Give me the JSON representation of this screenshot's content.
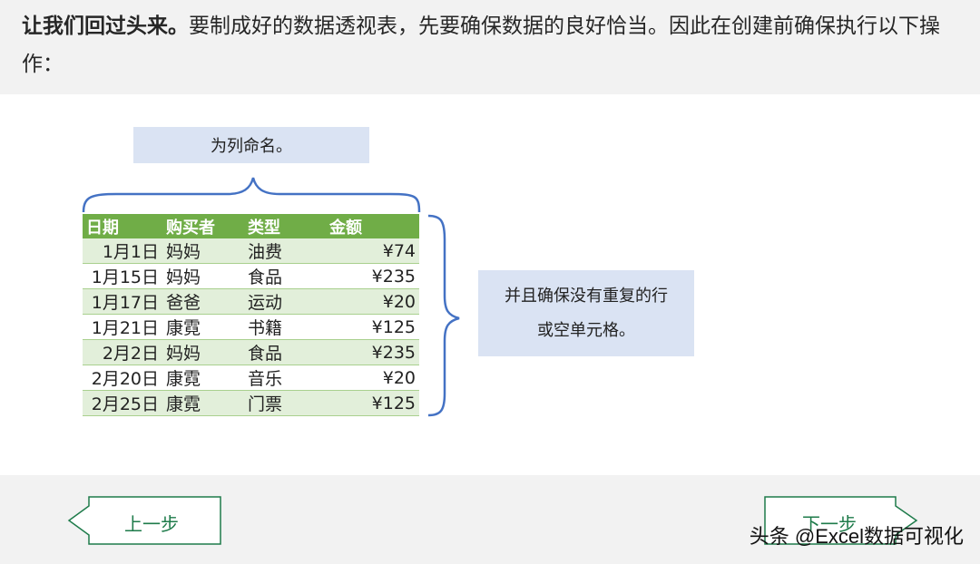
{
  "header": {
    "bold_text": "让我们回过头来。",
    "rest_text": "要制成好的数据透视表，先要确保数据的良好恰当。因此在创建前确保执行以下操作："
  },
  "callouts": {
    "top": "为列命名。",
    "right_line1": "并且确保没有重复的行",
    "right_line2": "或空单元格。"
  },
  "table": {
    "headers": [
      "日期",
      "购买者",
      "类型",
      "金额"
    ],
    "rows": [
      [
        "1月1日",
        "妈妈",
        "油费",
        "¥74"
      ],
      [
        "1月15日",
        "妈妈",
        "食品",
        "¥235"
      ],
      [
        "1月17日",
        "爸爸",
        "运动",
        "¥20"
      ],
      [
        "1月21日",
        "康霓",
        "书籍",
        "¥125"
      ],
      [
        "2月2日",
        "妈妈",
        "食品",
        "¥235"
      ],
      [
        "2月20日",
        "康霓",
        "音乐",
        "¥20"
      ],
      [
        "2月25日",
        "康霓",
        "门票",
        "¥125"
      ]
    ]
  },
  "nav": {
    "prev_label": "上一步",
    "next_label": "下一步"
  },
  "watermark": "头条 @Excel数据可视化",
  "colors": {
    "table_header": "#70ad47",
    "table_band": "#e2efda",
    "callout_bg": "#dae3f3",
    "brace": "#4472c4",
    "nav_green": "#1e7b4a"
  }
}
